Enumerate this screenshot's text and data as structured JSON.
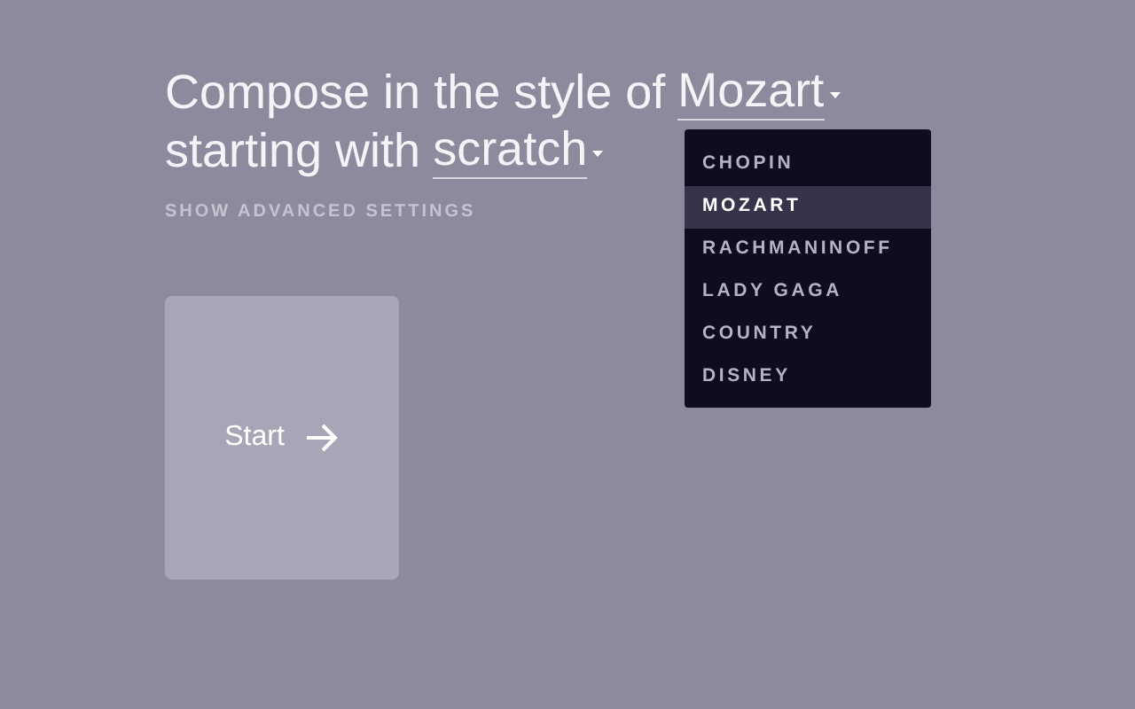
{
  "prompt_lines": [
    {
      "text": "Compose in the style of",
      "select_value": "Mozart"
    },
    {
      "text": "starting with",
      "select_value": "scratch"
    }
  ],
  "advanced_settings_link": "SHOW ADVANCED SETTINGS",
  "dropdown": {
    "items": [
      {
        "label": "CHOPIN",
        "selected": false
      },
      {
        "label": "MOZART",
        "selected": true
      },
      {
        "label": "RACHMANINOFF",
        "selected": false
      },
      {
        "label": "LADY GAGA",
        "selected": false
      },
      {
        "label": "COUNTRY",
        "selected": false
      },
      {
        "label": "DISNEY",
        "selected": false
      }
    ]
  },
  "start_button": {
    "label": "Start"
  }
}
